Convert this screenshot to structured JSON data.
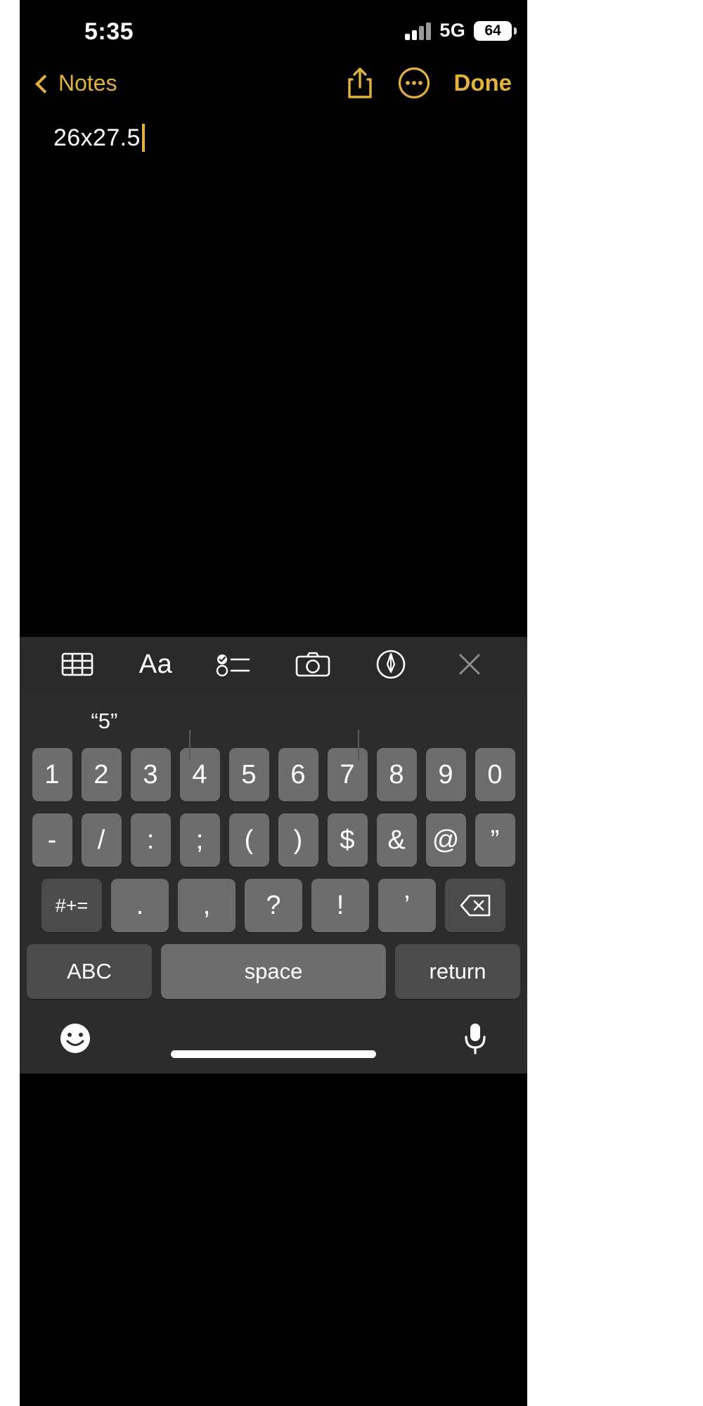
{
  "status_bar": {
    "time": "5:35",
    "network": "5G",
    "battery_percent": "64",
    "signal_icon": "cellular-signal-icon",
    "battery_icon": "battery-icon"
  },
  "nav_bar": {
    "back_label": "Notes",
    "back_icon": "chevron-left-icon",
    "share_icon": "share-icon",
    "more_icon": "more-options-icon",
    "done_label": "Done"
  },
  "note": {
    "text": "26x27.5",
    "cursor_visible": true
  },
  "format_toolbar": {
    "items": [
      {
        "name": "table-icon",
        "label": ""
      },
      {
        "name": "text-format-icon",
        "label": "Aa"
      },
      {
        "name": "checklist-icon",
        "label": ""
      },
      {
        "name": "camera-icon",
        "label": ""
      },
      {
        "name": "markup-pen-icon",
        "label": ""
      },
      {
        "name": "close-icon",
        "label": ""
      }
    ]
  },
  "keyboard": {
    "predictions": [
      "“5”",
      "",
      ""
    ],
    "row_numbers": [
      "1",
      "2",
      "3",
      "4",
      "5",
      "6",
      "7",
      "8",
      "9",
      "0"
    ],
    "row_symbols": [
      "-",
      "/",
      ":",
      ";",
      "(",
      ")",
      "$",
      "&",
      "@",
      "”"
    ],
    "row_third": {
      "modifier": "#+=",
      "keys": [
        ".",
        ",",
        "?",
        "!",
        "’"
      ],
      "backspace_icon": "backspace-icon"
    },
    "row_bottom": {
      "abc": "ABC",
      "space": "space",
      "return": "return"
    },
    "emoji_icon": "emoji-icon",
    "dictation_icon": "microphone-icon"
  },
  "colors": {
    "accent": "#e3b23c",
    "note_background": "#000000",
    "keyboard_background": "#2c2c2c",
    "key_light": "#6d6d6d",
    "key_dark": "#4b4b4b"
  }
}
